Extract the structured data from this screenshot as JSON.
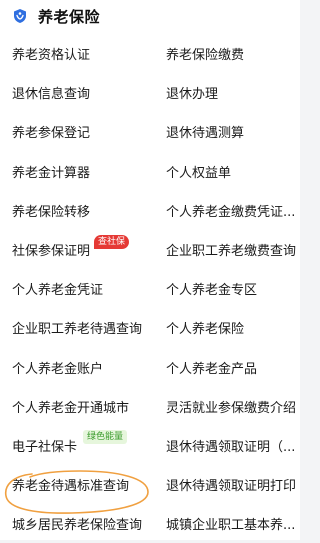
{
  "header": {
    "title": "养老保险",
    "logo_icon": "shield-logo-icon"
  },
  "rows": [
    {
      "left": {
        "label": "养老资格认证"
      },
      "right": {
        "label": "养老保险缴费"
      }
    },
    {
      "left": {
        "label": "退休信息查询"
      },
      "right": {
        "label": "退休办理"
      }
    },
    {
      "left": {
        "label": "养老参保登记"
      },
      "right": {
        "label": "退休待遇测算"
      }
    },
    {
      "left": {
        "label": "养老金计算器"
      },
      "right": {
        "label": "个人权益单"
      }
    },
    {
      "left": {
        "label": "养老保险转移"
      },
      "right": {
        "label": "个人养老金缴费凭证..."
      }
    },
    {
      "left": {
        "label": "社保参保证明",
        "badge": "查社保"
      },
      "right": {
        "label": "企业职工养老缴费查询"
      }
    },
    {
      "left": {
        "label": "个人养老金凭证"
      },
      "right": {
        "label": "个人养老金专区"
      }
    },
    {
      "left": {
        "label": "企业职工养老待遇查询"
      },
      "right": {
        "label": "个人养老保险"
      }
    },
    {
      "left": {
        "label": "个人养老金账户"
      },
      "right": {
        "label": "个人养老金产品"
      }
    },
    {
      "left": {
        "label": "个人养老金开通城市"
      },
      "right": {
        "label": "灵活就业参保缴费介绍"
      }
    },
    {
      "left": {
        "label": "电子社保卡",
        "badge": "绿色能量"
      },
      "right": {
        "label": "退休待遇领取证明（..."
      }
    },
    {
      "left": {
        "label": "养老金待遇标准查询"
      },
      "right": {
        "label": "退休待遇领取证明打印"
      }
    },
    {
      "left": {
        "label": "城乡居民养老保险查询"
      },
      "right": {
        "label": "城镇企业职工基本养..."
      }
    }
  ],
  "colors": {
    "accent": "#2f6fe0",
    "badge_red": "#e53935",
    "badge_green": "#3a9a2b",
    "highlight_circle": "#f0a040"
  }
}
